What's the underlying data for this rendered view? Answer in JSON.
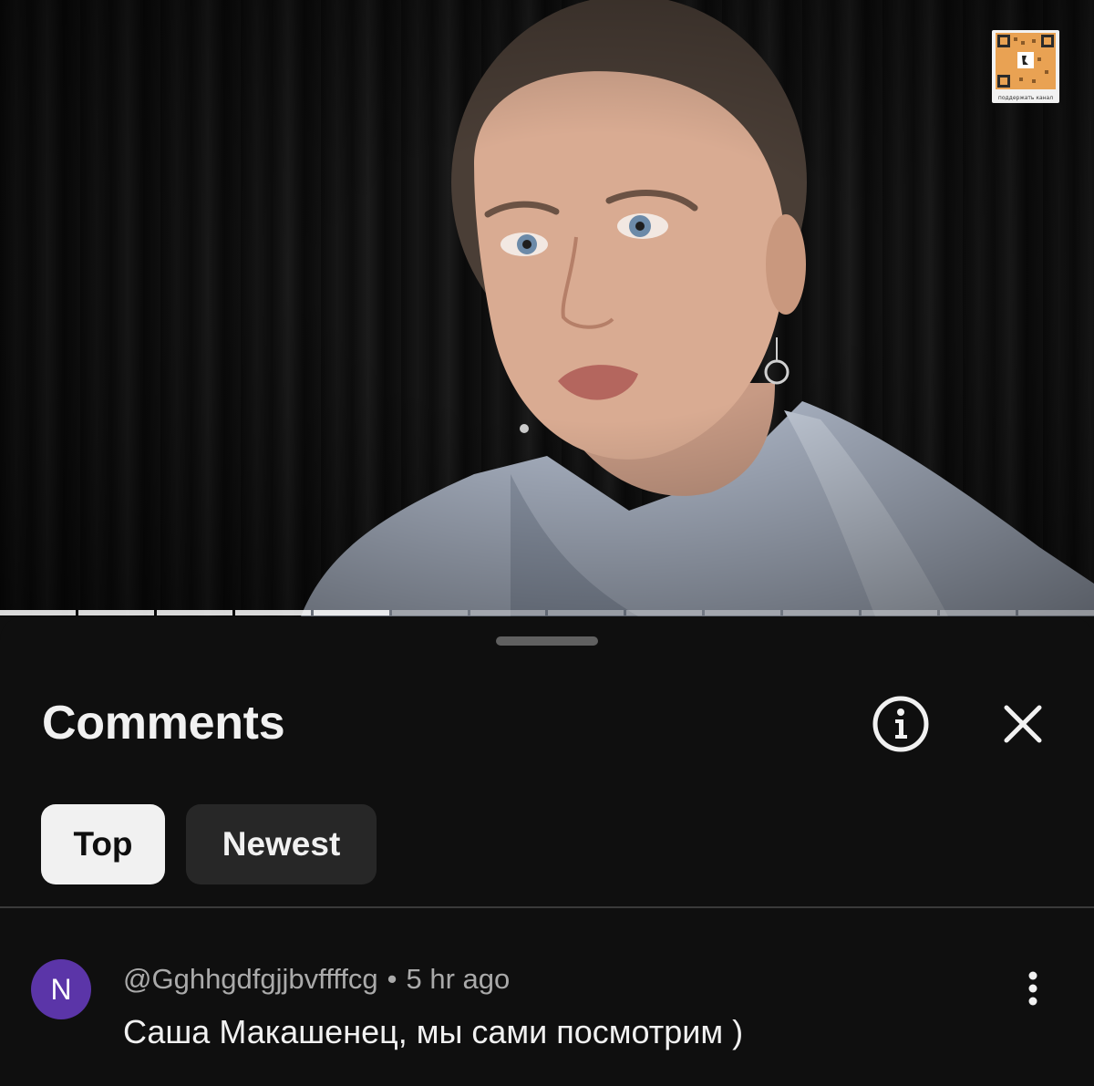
{
  "video": {
    "qr_caption": "поддержать канал",
    "progress_fraction": 0.42,
    "segments_total": 14,
    "segments_watched": 5
  },
  "comments_panel": {
    "title": "Comments",
    "info_icon": "info-circle-icon",
    "close_icon": "close-x-icon",
    "sort_chips": [
      {
        "label": "Top",
        "selected": true
      },
      {
        "label": "Newest",
        "selected": false
      }
    ]
  },
  "comments": [
    {
      "avatar_letter": "N",
      "avatar_color": "#5b35a8",
      "author": "@Gghhgdfgjjbvffffcg",
      "separator": "•",
      "time": "5 hr ago",
      "text": "Саша Макашенец, мы сами посмотрим )",
      "menu_icon": "more-vertical-icon"
    }
  ],
  "colors": {
    "background": "#0f0f0f",
    "text_primary": "#f1f1f1",
    "text_secondary": "#aaaaaa",
    "chip_inactive": "#272727"
  }
}
